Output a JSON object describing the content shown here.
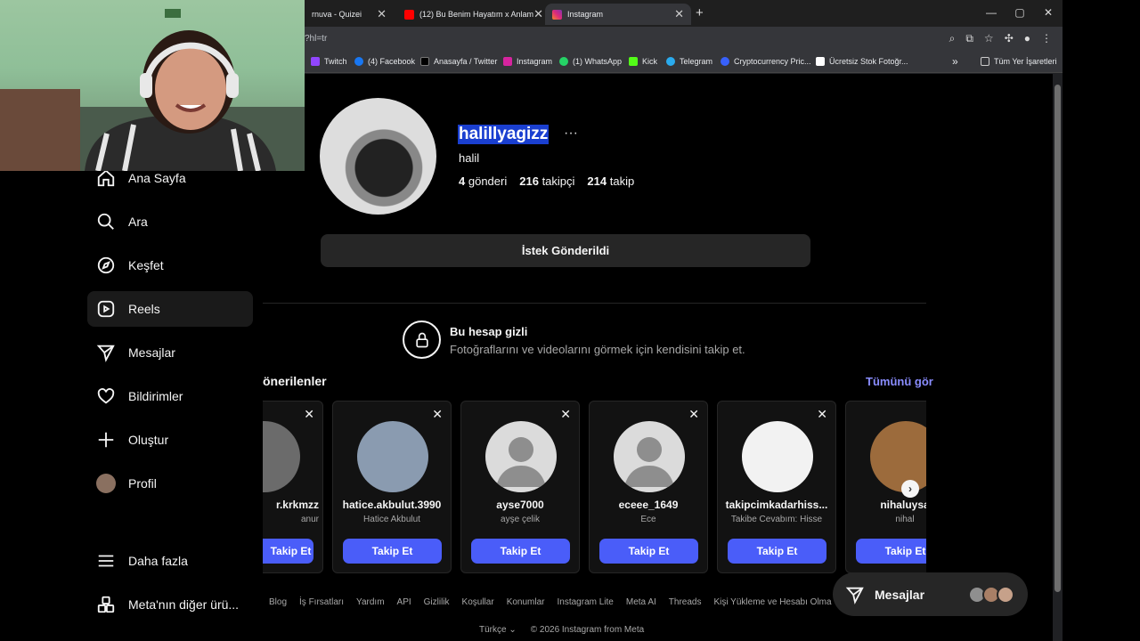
{
  "tabs": [
    {
      "title": "rnuva - Quizei",
      "color": "#333"
    },
    {
      "title": "(12) Bu Benim Hayatım x Anlam",
      "color": "#ff0000"
    },
    {
      "title": "Instagram",
      "color": "#d6249f",
      "active": true
    }
  ],
  "url": "?hl=tr",
  "bookmarks": [
    {
      "label": "Twitch",
      "color": "#9146ff"
    },
    {
      "label": "(4) Facebook",
      "color": "#1877f2"
    },
    {
      "label": "Anasayfa / Twitter",
      "color": "#000000"
    },
    {
      "label": "Instagram",
      "color": "#d6249f"
    },
    {
      "label": "(1) WhatsApp",
      "color": "#25d366"
    },
    {
      "label": "Kick",
      "color": "#53fc18"
    },
    {
      "label": "Telegram",
      "color": "#2aabee"
    },
    {
      "label": "Cryptocurrency Pric...",
      "color": "#3861fb"
    },
    {
      "label": "Ücretsiz Stok Fotoğr...",
      "color": "#ffffff"
    }
  ],
  "bookmarks_more": "»",
  "all_bookmarks": "Tüm Yer İşaretleri",
  "sidebar": {
    "items": [
      {
        "label": "Ana Sayfa",
        "icon": "home-icon"
      },
      {
        "label": "Ara",
        "icon": "search-icon"
      },
      {
        "label": "Keşfet",
        "icon": "compass-icon"
      },
      {
        "label": "Reels",
        "icon": "reels-icon"
      },
      {
        "label": "Mesajlar",
        "icon": "send-icon"
      },
      {
        "label": "Bildirimler",
        "icon": "heart-icon"
      },
      {
        "label": "Oluştur",
        "icon": "plus-icon"
      },
      {
        "label": "Profil",
        "icon": "avatar-icon"
      }
    ],
    "more": "Daha fazla",
    "meta": "Meta'nın diğer ürü..."
  },
  "profile": {
    "username": "halillyagizz",
    "more": "···",
    "fullname": "halil",
    "posts_count": "4",
    "posts_label": "gönderi",
    "followers_count": "216",
    "followers_label": "takipçi",
    "following_count": "214",
    "following_label": "takip",
    "request_button": "İstek Gönderildi"
  },
  "private": {
    "title": "Bu hesap gizli",
    "description": "Fotoğraflarını ve videolarını görmek için kendisini takip et."
  },
  "suggested": {
    "title": "önerilenler",
    "see_all": "Tümünü gör",
    "close": "✕",
    "follow_label": "Takip Et",
    "cards": [
      {
        "username": "r.krkmzz",
        "name": "anur",
        "pic": "#3b3b3b"
      },
      {
        "username": "hatice.akbulut.3990",
        "name": "Hatice Akbulut",
        "pic": "#8a9bb0"
      },
      {
        "username": "ayse7000",
        "name": "ayşe çelik",
        "pic": "default"
      },
      {
        "username": "eceee_1649",
        "name": "Ece",
        "pic": "default"
      },
      {
        "username": "takipcimkadarhiss...",
        "name": "Takibe Cevabım: Hisse",
        "pic": "#f2f2f2"
      },
      {
        "username": "nihaluysa",
        "name": "nihal",
        "pic": "#9c6b3c"
      }
    ]
  },
  "footer": {
    "links": [
      "Blog",
      "İş Fırsatları",
      "Yardım",
      "API",
      "Gizlilik",
      "Koşullar",
      "Konumlar",
      "Instagram Lite",
      "Meta AI",
      "Threads",
      "Kişi Yükleme ve Hesabı Olma"
    ],
    "language": "Türkçe",
    "copyright": "© 2026 Instagram from Meta"
  },
  "messages_pill": {
    "label": "Mesajlar"
  }
}
